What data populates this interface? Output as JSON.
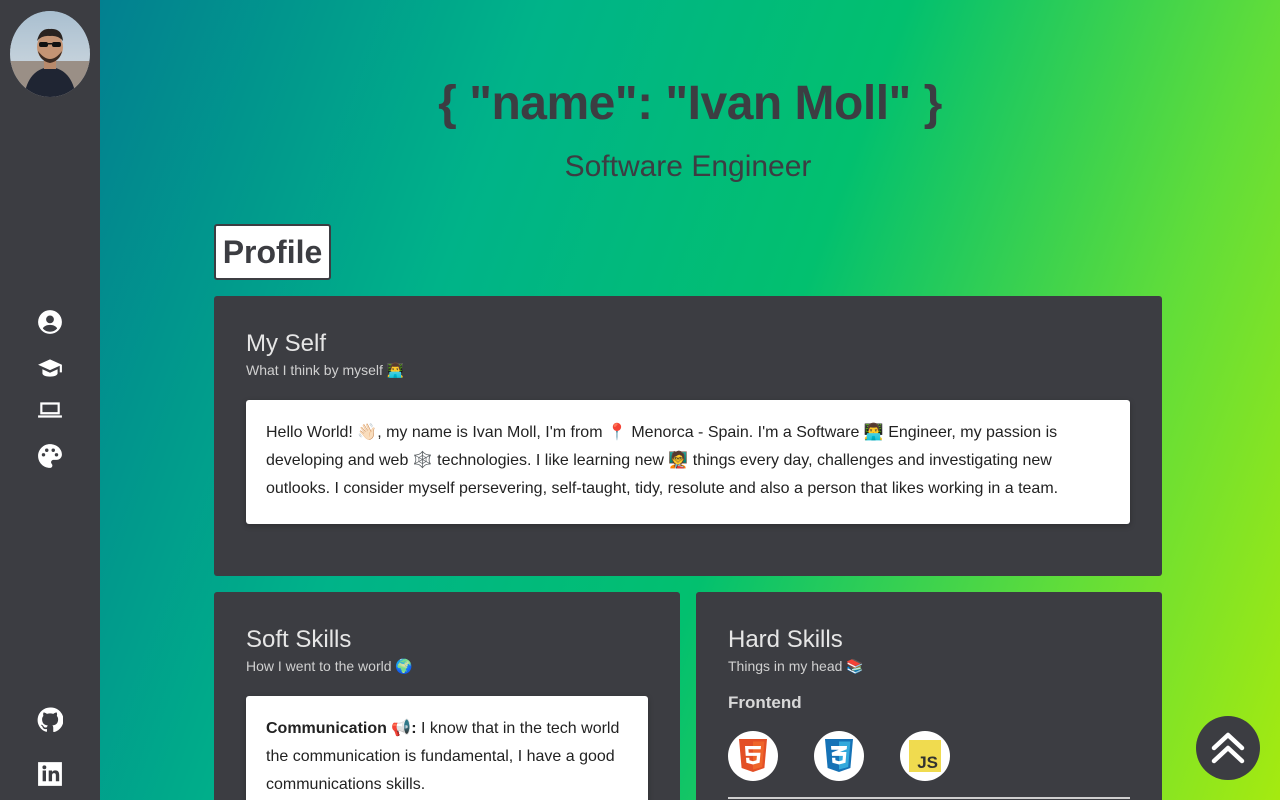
{
  "sidebar": {
    "avatar_alt": "Ivan Moll",
    "nav": [
      {
        "icon": "user-circle-icon"
      },
      {
        "icon": "graduation-cap-icon"
      },
      {
        "icon": "laptop-code-icon"
      },
      {
        "icon": "palette-icon"
      }
    ],
    "social": [
      {
        "icon": "github-icon"
      },
      {
        "icon": "linkedin-icon"
      }
    ]
  },
  "hero": {
    "title": "{ \"name\": \"Ivan Moll\" }",
    "subtitle": "Software Engineer"
  },
  "profile": {
    "section_title": "Profile",
    "my_self": {
      "title": "My Self",
      "subtitle": "What I think by myself 👨‍💻",
      "text": "Hello World! 👋🏻, my name is Ivan Moll, I'm from 📍 Menorca - Spain. I'm a Software 👨‍💻 Engineer, my passion is developing and web 🕸️ technologies. I like learning new 🧑‍🏫 things every day, challenges and investigating new outlooks. I consider myself persevering, self-taught, tidy, resolute and also a person that likes working in a team."
    },
    "soft_skills": {
      "title": "Soft Skills",
      "subtitle": "How I went to the world 🌍",
      "items": [
        {
          "label": "Communication 📢:",
          "text": " I know that in the tech world the communication is fundamental, I have a good communications skills."
        }
      ]
    },
    "hard_skills": {
      "title": "Hard Skills",
      "subtitle": "Things in my head 📚",
      "groups": [
        {
          "name": "Frontend",
          "techs": [
            {
              "icon": "html5-icon"
            },
            {
              "icon": "css3-icon"
            },
            {
              "icon": "javascript-icon",
              "text": "JS"
            }
          ]
        }
      ]
    }
  },
  "colors": {
    "sidebar": "#3c3d42",
    "card": "#3c3d42",
    "gradient_start": "#028090",
    "gradient_end": "#a5ea10",
    "html5": "#e34f26",
    "css3": "#1572b6",
    "js": "#f0db4f"
  }
}
